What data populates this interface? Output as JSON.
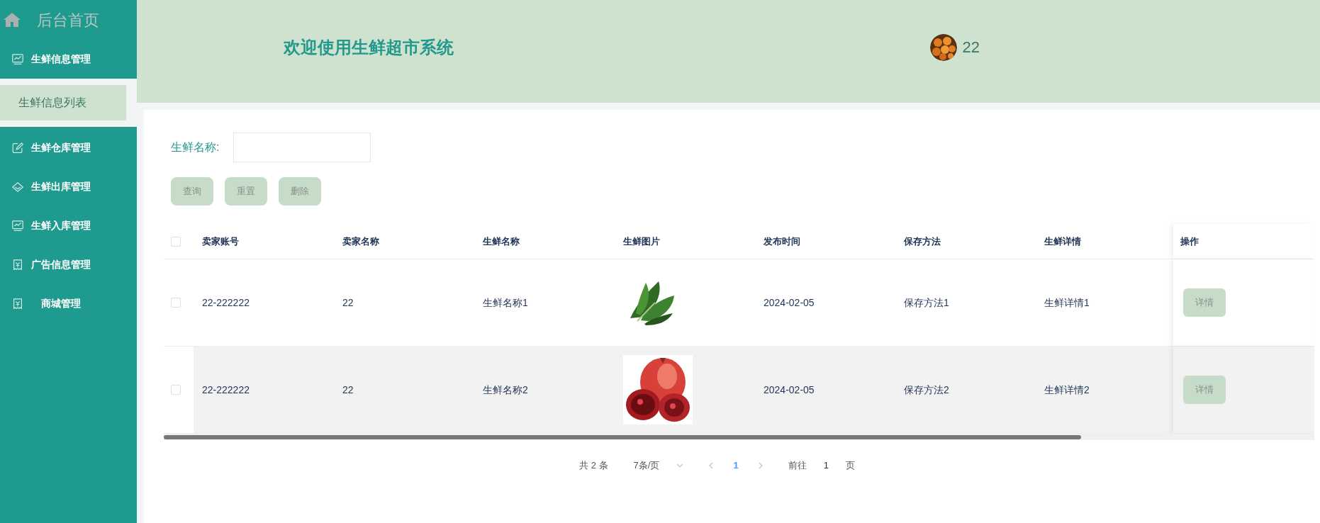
{
  "sidebar": {
    "home": {
      "label": "后台首页"
    },
    "items": [
      {
        "label": "生鲜信息管理",
        "kind": "chart",
        "children": [
          {
            "label": "生鲜信息列表",
            "selected": true
          }
        ]
      },
      {
        "label": "生鲜仓库管理",
        "kind": "edit"
      },
      {
        "label": "生鲜出库管理",
        "kind": "diamond"
      },
      {
        "label": "生鲜入库管理",
        "kind": "chart"
      },
      {
        "label": "广告信息管理",
        "kind": "receipt"
      },
      {
        "label": "商城管理",
        "kind": "receipt"
      }
    ]
  },
  "header": {
    "title": "欢迎使用生鲜超市系统",
    "user": "22"
  },
  "search": {
    "label": "生鲜名称:",
    "buttons": [
      "查询",
      "重置",
      "删除"
    ]
  },
  "table": {
    "all_checked": false,
    "columns": [
      "卖家账号",
      "卖家名称",
      "生鲜名称",
      "生鲜图片",
      "发布时间",
      "保存方法",
      "生鲜详情",
      "操作"
    ],
    "rows": [
      {
        "checked": false,
        "highlighted": false,
        "cells": [
          "22-222222",
          "22",
          "生鲜名称1",
          {
            "kind": "picture"
          },
          "2024-02-05",
          "保存方法1",
          "生鲜详情1"
        ],
        "action": "详情"
      },
      {
        "checked": false,
        "highlighted": true,
        "cells": [
          "22-222222",
          "22",
          "生鲜名称2",
          {
            "kind": "picture"
          },
          "2024-02-05",
          "保存方法2",
          "生鲜详情2"
        ],
        "action": "详情"
      }
    ]
  },
  "pagination": {
    "total": "共 2 条",
    "page_size": "7条/页",
    "pages": [
      {
        "label": "1",
        "selected": true
      }
    ],
    "goto_label": "前往",
    "goto_value": "1",
    "goto_suffix": "页"
  }
}
